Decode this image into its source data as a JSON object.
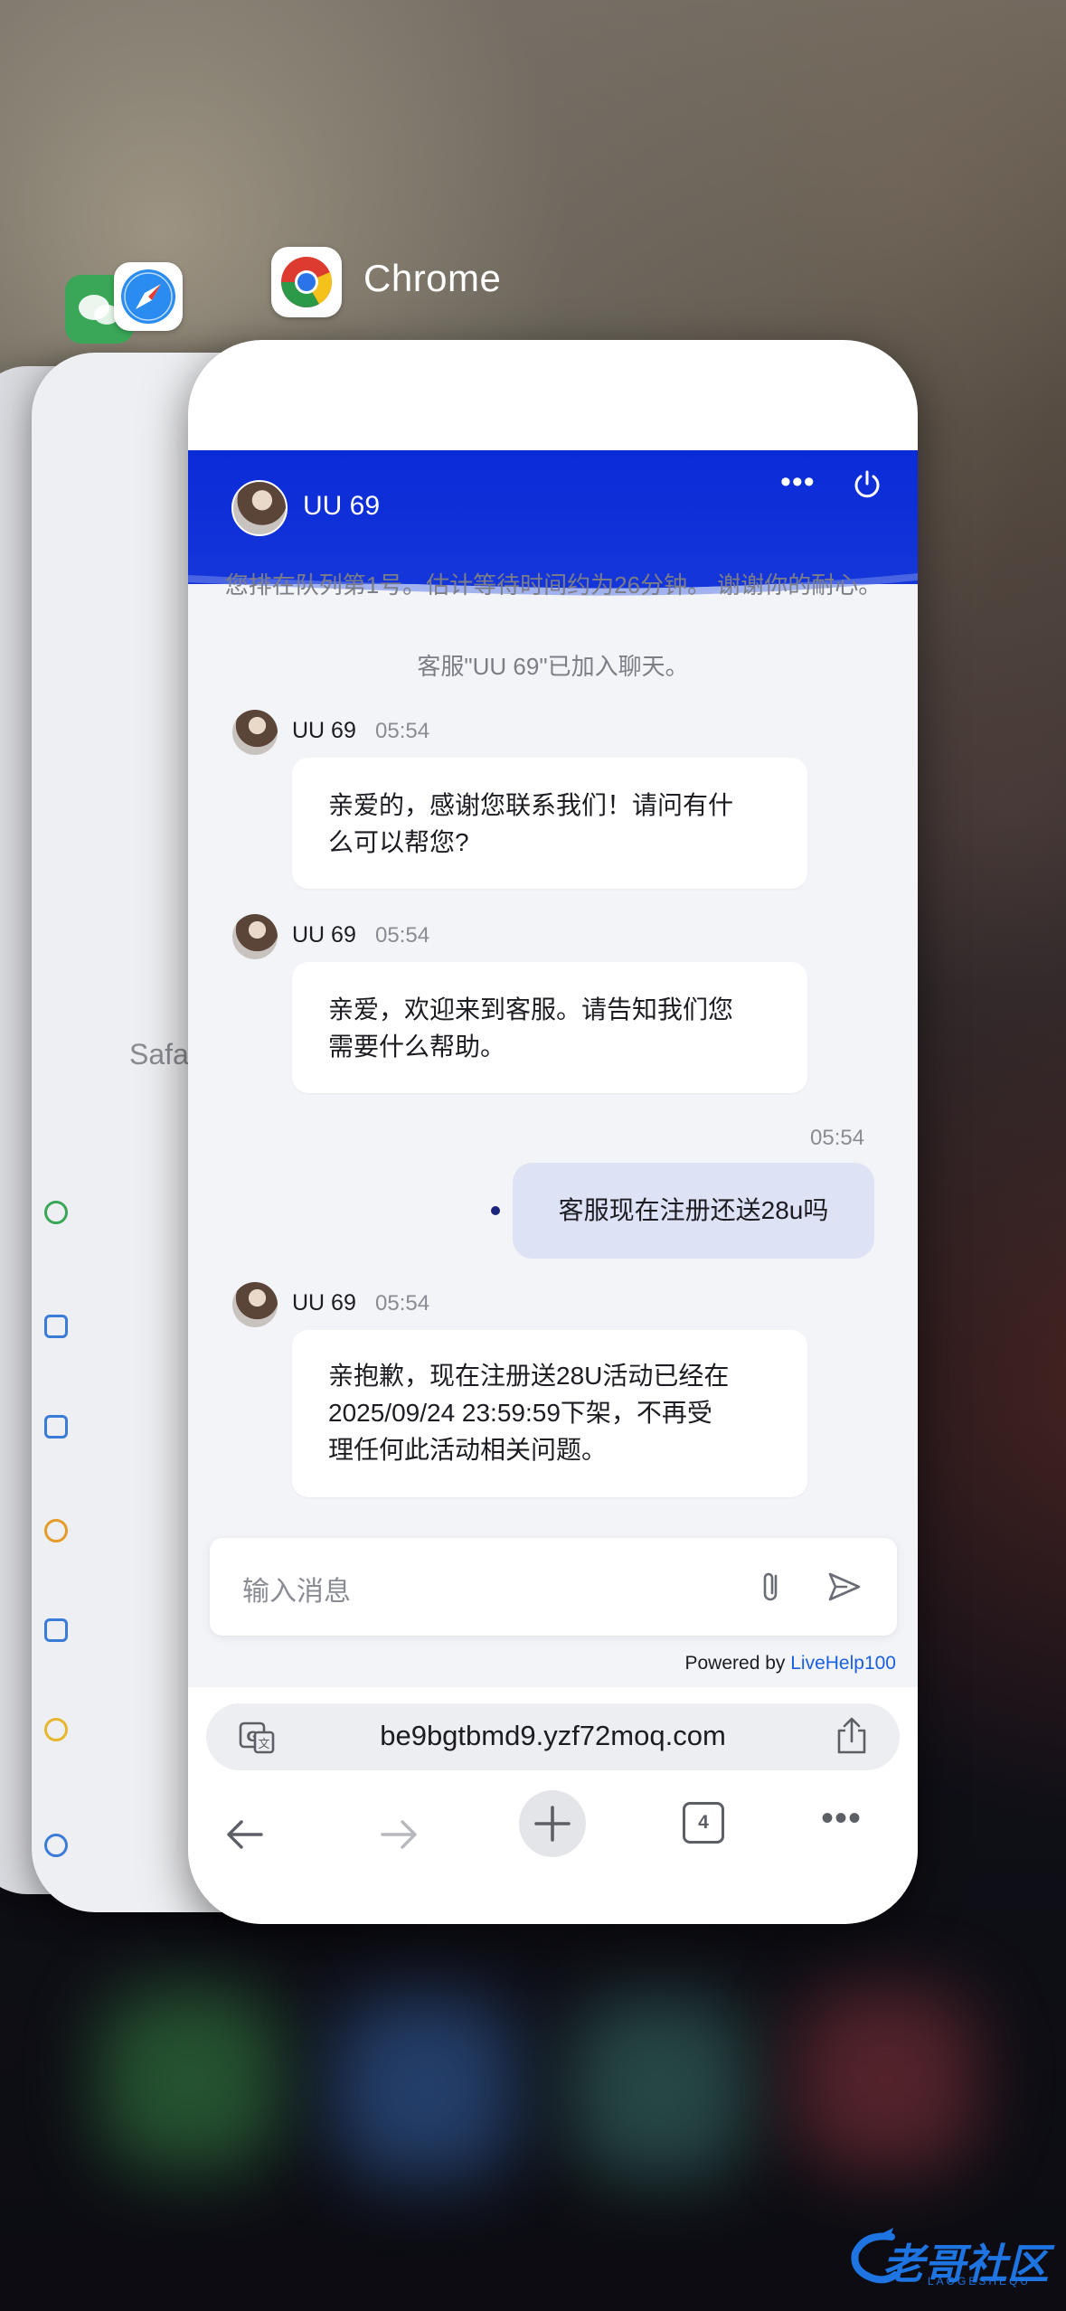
{
  "switcher": {
    "active_app_name": "Chrome",
    "background_app_label": "Safa"
  },
  "chat": {
    "agent_name": "UU 69",
    "system_queue_text": "您排在队列第1号。估计等待时间约为26分钟。 谢谢你的耐心。",
    "system_joined_text": "客服\"UU 69\"已加入聊天。",
    "messages": [
      {
        "sender": "UU 69",
        "time": "05:54",
        "text_lines": [
          "亲爱的，感谢您联系我们！请问有什",
          "么可以帮您?"
        ]
      },
      {
        "sender": "UU 69",
        "time": "05:54",
        "text_lines": [
          "亲爱，欢迎来到客服。请告知我们您",
          "需要什么帮助。"
        ]
      },
      {
        "sender": "me",
        "time": "05:54",
        "text": "客服现在注册还送28u吗"
      },
      {
        "sender": "UU 69",
        "time": "05:54",
        "text_lines": [
          "亲抱歉，现在注册送28U活动已经在",
          "2025/09/24 23:59:59下架，不再受",
          "理任何此活动相关问题。"
        ]
      }
    ],
    "input_placeholder": "输入消息",
    "powered_by_prefix": "Powered by ",
    "powered_by_link": "LiveHelp100"
  },
  "browser": {
    "url": "be9bgtbmd9.yzf72moq.com",
    "tab_count": "4"
  },
  "watermark": {
    "text": "老哥社区",
    "sub": "LAOGESHEQU"
  },
  "colors": {
    "header_blue": "#0a2bd8",
    "link_blue": "#1a5fe0",
    "outgoing_bubble": "#dde2f4"
  }
}
